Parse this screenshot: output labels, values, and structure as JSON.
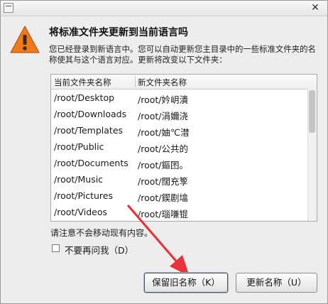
{
  "dialog": {
    "heading": "将标准文件夹更新到当前语言吗",
    "description": "您已经登录到新语言中。您可以自动更新您主目录中的一些标准文件夹的名称使其与这个语言对应。更新将改变以下文件夹：",
    "columns": [
      "当前文件夹名称",
      "新文件夹名称"
    ],
    "rows": [
      {
        "current": "/root/Desktop",
        "new": "/root/妗岄潰"
      },
      {
        "current": "/root/Downloads",
        "new": "/root/涓嬭浇"
      },
      {
        "current": "/root/Templates",
        "new": "/root/妯℃澘"
      },
      {
        "current": "/root/Public",
        "new": "/root/公共的"
      },
      {
        "current": "/root/Documents",
        "new": "/root/鏂囨。"
      },
      {
        "current": "/root/Music",
        "new": "/root/闊充箰"
      },
      {
        "current": "/root/Pictures",
        "new": "/root/鍥剧墖"
      },
      {
        "current": "/root/Videos",
        "new": "/root/瑙嗛锟"
      }
    ],
    "note": "请注意不会移动现有内容。",
    "dont_ask_label": "不要再问我（D）",
    "dont_ask_checked": false,
    "keep_button": "保留旧名称（K）",
    "update_button": "更新名称（U）"
  },
  "titlebar": {
    "close_glyph": "✕"
  },
  "icons": {
    "warning": "warning-icon",
    "close": "close-icon",
    "window_menu": "window-menu-icon",
    "annotation": "red-arrow-annotation"
  },
  "colors": {
    "warning_fill": "#f07a1b",
    "arrow": "#e8323c"
  }
}
